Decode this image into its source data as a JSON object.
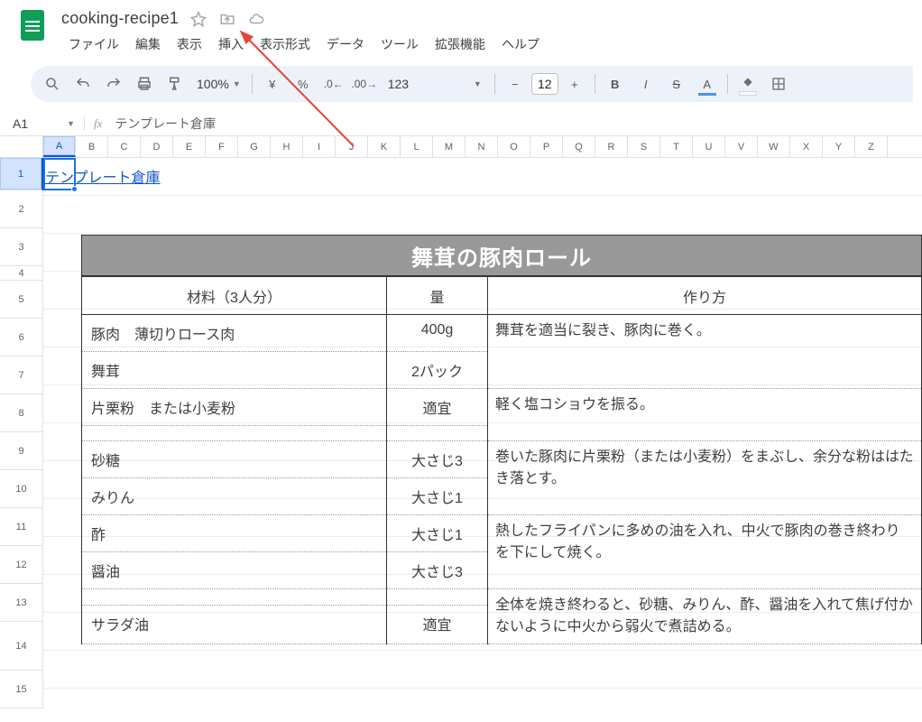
{
  "doc_title": "cooking-recipe1",
  "menu": [
    "ファイル",
    "編集",
    "表示",
    "挿入",
    "表示形式",
    "データ",
    "ツール",
    "拡張機能",
    "ヘルプ"
  ],
  "zoom": "100%",
  "format_default": "123",
  "font_size": "12",
  "name_box": "A1",
  "formula": "テンプレート倉庫",
  "columns": [
    "A",
    "B",
    "C",
    "D",
    "E",
    "F",
    "G",
    "H",
    "I",
    "J",
    "K",
    "L",
    "M",
    "N",
    "O",
    "P",
    "Q",
    "R",
    "S",
    "T",
    "U",
    "V",
    "W",
    "X",
    "Y",
    "Z"
  ],
  "rows": [
    "1",
    "2",
    "3",
    "4",
    "5",
    "6",
    "7",
    "8",
    "9",
    "10",
    "11",
    "12",
    "13",
    "14",
    "15"
  ],
  "link_a1": "テンプレート倉庫",
  "recipe": {
    "title": "舞茸の豚肉ロール",
    "headers": {
      "ing": "材料（3人分）",
      "amt": "量",
      "inst": "作り方"
    },
    "rows": [
      {
        "ing": "豚肉　薄切りロース肉",
        "amt": "400g",
        "inst": "舞茸を適当に裂き、豚肉に巻く。"
      },
      {
        "ing": "舞茸",
        "amt": "2パック",
        "inst": ""
      },
      {
        "ing": "片栗粉　または小麦粉",
        "amt": "適宜",
        "inst": "軽く塩コショウを振る。"
      },
      {
        "ing": "",
        "amt": "",
        "inst": ""
      },
      {
        "ing": "砂糖",
        "amt": "大さじ3",
        "inst": "巻いた豚肉に片栗粉（または小麦粉）をまぶし、余分な粉ははたき落とす。"
      },
      {
        "ing": "みりん",
        "amt": "大さじ1",
        "inst": ""
      },
      {
        "ing": "酢",
        "amt": "大さじ1",
        "inst": "熱したフライパンに多めの油を入れ、中火で豚肉の巻き終わりを下にして焼く。"
      },
      {
        "ing": "醤油",
        "amt": "大さじ3",
        "inst": ""
      },
      {
        "ing": "",
        "amt": "",
        "inst": "全体を焼き終わると、砂糖、みりん、酢、醤油を入れて焦げ付かないように中火から弱火で煮詰める。"
      },
      {
        "ing": "サラダ油",
        "amt": "適宜",
        "inst": ""
      }
    ]
  }
}
